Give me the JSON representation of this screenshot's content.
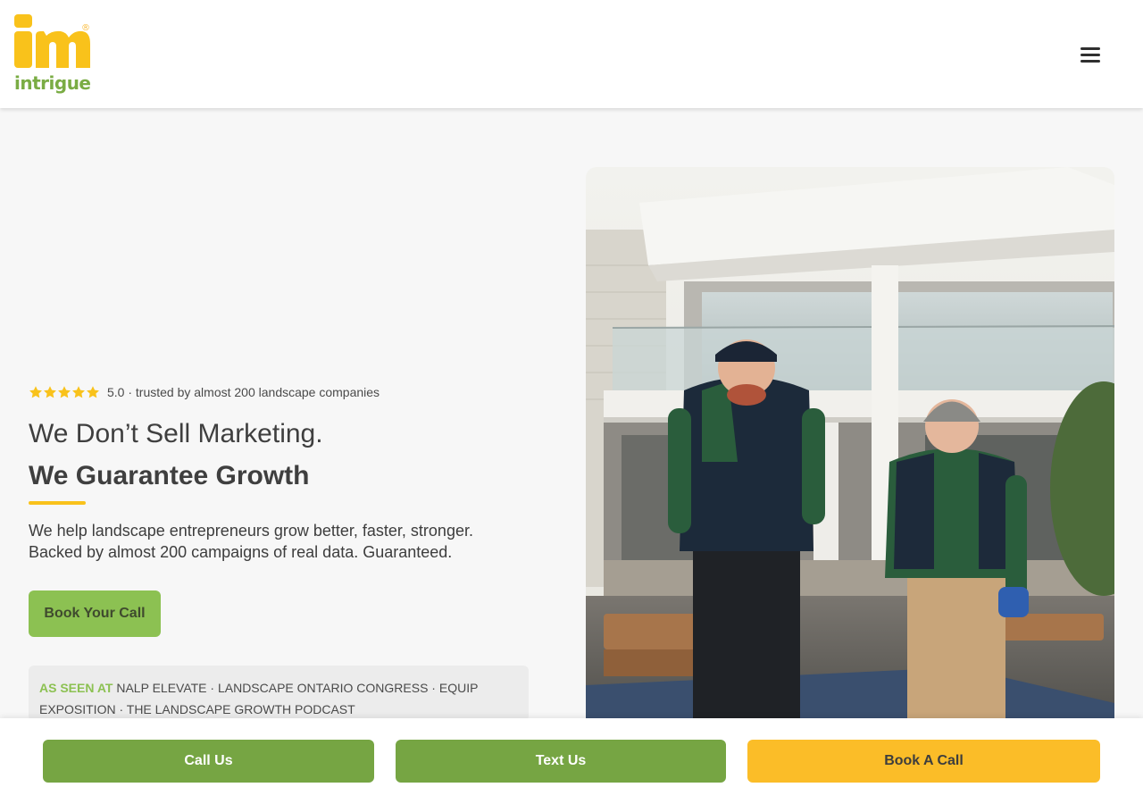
{
  "brand": {
    "logo_mark": "m",
    "logo_word": "intrigue",
    "logo_registered": "®",
    "colors": {
      "yellow": "#f9c21b",
      "green": "#7aac44"
    }
  },
  "header": {
    "menu_icon": "hamburger-menu-icon"
  },
  "hero": {
    "rating": {
      "stars": 5,
      "score_text": "5.0 · trusted by almost 200 landscape companies"
    },
    "headline_line1": "We Don’t Sell Marketing.",
    "headline_line2": "We Guarantee Growth",
    "subcopy_line1": "We help landscape entrepreneurs grow better, faster, stronger.",
    "subcopy_line2": "Backed by almost 200 campaigns of real data. Guaranteed.",
    "cta_label": "Book Your Call",
    "as_seen_label": "AS SEEN AT",
    "as_seen_text": "NALP ELEVATE · LANDSCAPE ONTARIO CONGRESS · EQUIP EXPOSITION · THE LANDSCAPE GROWTH PODCAST"
  },
  "bottom_bar": {
    "call_label": "Call Us",
    "text_label": "Text Us",
    "book_label": "Book A Call",
    "colors": {
      "green": "#76a543",
      "yellow": "#fbbd28"
    }
  }
}
